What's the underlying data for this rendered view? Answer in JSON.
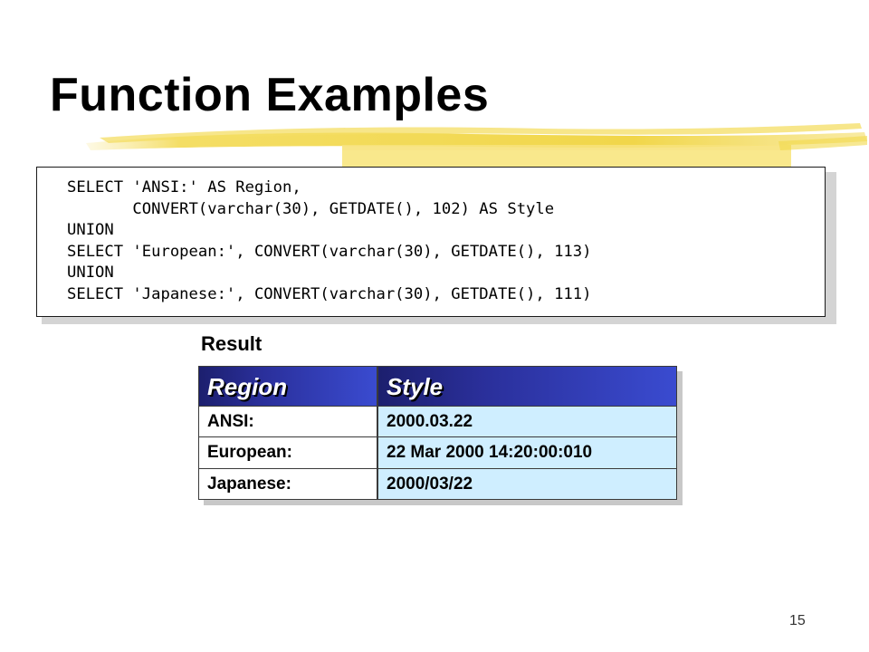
{
  "slide": {
    "title": "Function Examples",
    "page_number": "15"
  },
  "code": {
    "lines": [
      "SELECT 'ANSI:' AS Region,",
      "       CONVERT(varchar(30), GETDATE(), 102) AS Style",
      "UNION",
      "SELECT 'European:', CONVERT(varchar(30), GETDATE(), 113)",
      "UNION",
      "SELECT 'Japanese:', CONVERT(varchar(30), GETDATE(), 111)"
    ]
  },
  "result": {
    "label": "Result",
    "columns": [
      "Region",
      "Style"
    ],
    "rows": [
      [
        "ANSI:",
        "2000.03.22"
      ],
      [
        "European:",
        "22 Mar 2000 14:20:00:010"
      ],
      [
        "Japanese:",
        "2000/03/22"
      ]
    ]
  },
  "colors": {
    "header_gradient_start": "#1c1f6e",
    "header_gradient_end": "#3a4bd0",
    "style_cell_bg": "#cfeeff",
    "highlighter_yellow": "#f2d84a"
  }
}
